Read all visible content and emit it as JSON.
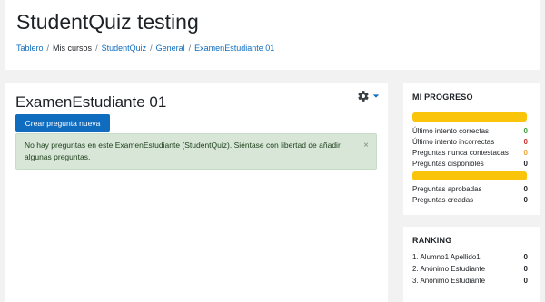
{
  "header": {
    "site_title": "StudentQuiz testing",
    "breadcrumb": [
      "Tablero",
      "Mis cursos",
      "StudentQuiz",
      "General",
      "ExamenEstudiante 01"
    ]
  },
  "main": {
    "heading": "ExamenEstudiante 01",
    "create_button": "Crear pregunta nueva",
    "alert_text": "No hay preguntas en este ExamenEstudiante (StudentQuiz). Siéntase con libertad de añadir algunas preguntas.",
    "alert_close": "×"
  },
  "progress": {
    "title": "MI PROGRESO",
    "rows": [
      {
        "label": "Último intento correctas",
        "value": "0",
        "color": "#399c34"
      },
      {
        "label": "Último intento incorrectas",
        "value": "0",
        "color": "#c9302c"
      },
      {
        "label": "Preguntas nunca contestadas",
        "value": "0",
        "color": "#f0a030"
      },
      {
        "label": "Preguntas disponibles",
        "value": "0",
        "color": "#1d2125"
      },
      {
        "label": "Preguntas aprobadas",
        "value": "0",
        "color": "#1d2125"
      },
      {
        "label": "Preguntas creadas",
        "value": "0",
        "color": "#1d2125"
      }
    ],
    "bar_color": "#f9c40a"
  },
  "ranking": {
    "title": "RANKING",
    "rows": [
      {
        "label": "1. Alumno1 Apellido1",
        "value": "0"
      },
      {
        "label": "2. Anónimo Estudiante",
        "value": "0"
      },
      {
        "label": "3. Anónimo Estudiante",
        "value": "0"
      }
    ]
  },
  "colors": {
    "accent": "#0f6cbf",
    "alert_bg": "#d7e6d6"
  },
  "icons": {
    "gear": "gear-icon",
    "dropdown": "caret-down-icon"
  }
}
